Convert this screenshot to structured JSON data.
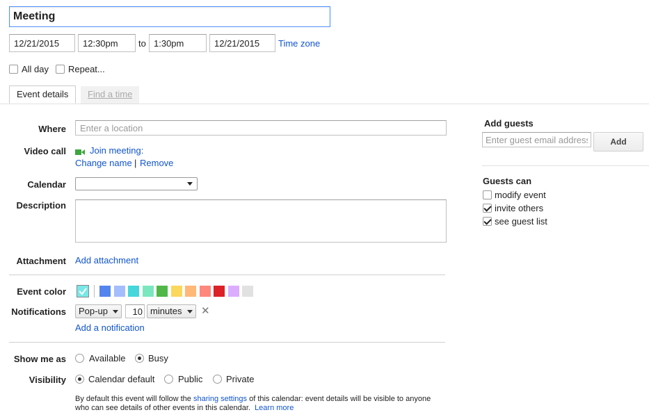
{
  "title": {
    "value": "Meeting"
  },
  "datetime": {
    "start_date": "12/21/2015",
    "start_time": "12:30pm",
    "to_label": "to",
    "end_time": "1:30pm",
    "end_date": "12/21/2015",
    "timezone_link": "Time zone"
  },
  "options": {
    "all_day": "All day",
    "repeat": "Repeat..."
  },
  "tabs": [
    {
      "label": "Event details",
      "active": true
    },
    {
      "label": "Find a time",
      "active": false
    }
  ],
  "where": {
    "label": "Where",
    "placeholder": "Enter a location"
  },
  "video_call": {
    "label": "Video call",
    "join": "Join meeting:",
    "change_name": "Change name",
    "separator": "|",
    "remove": "Remove",
    "icon": "video-camera-icon"
  },
  "calendar": {
    "label": "Calendar",
    "value": ""
  },
  "description": {
    "label": "Description",
    "value": ""
  },
  "attachment": {
    "label": "Attachment",
    "link": "Add attachment"
  },
  "event_color": {
    "label": "Event color",
    "selected": "#7ae7e7",
    "swatches": [
      "#5484ed",
      "#a4bdfc",
      "#46d6db",
      "#7ae7bf",
      "#51b749",
      "#fbd75b",
      "#ffb878",
      "#ff887c",
      "#dc2127",
      "#dbadff",
      "#e1e1e1"
    ]
  },
  "notifications": {
    "label": "Notifications",
    "type": "Pop-up",
    "amount": "10",
    "unit": "minutes",
    "remove_icon": "close-icon",
    "add_link": "Add a notification"
  },
  "show_me_as": {
    "label": "Show me as",
    "options": [
      {
        "label": "Available",
        "selected": false
      },
      {
        "label": "Busy",
        "selected": true
      }
    ]
  },
  "visibility": {
    "label": "Visibility",
    "options": [
      {
        "label": "Calendar default",
        "selected": true
      },
      {
        "label": "Public",
        "selected": false
      },
      {
        "label": "Private",
        "selected": false
      }
    ],
    "note_pre": "By default this event will follow the ",
    "note_link": "sharing settings",
    "note_post": " of this calendar: event details will be visible to anyone",
    "note_line2": "who can see details of other events in this calendar.",
    "learn_more": "Learn more"
  },
  "guests": {
    "title": "Add guests",
    "placeholder": "Enter guest email addresses",
    "add_button": "Add",
    "can_title": "Guests can",
    "permissions": [
      {
        "label": "modify event",
        "checked": false
      },
      {
        "label": "invite others",
        "checked": true
      },
      {
        "label": "see guest list",
        "checked": true
      }
    ]
  }
}
